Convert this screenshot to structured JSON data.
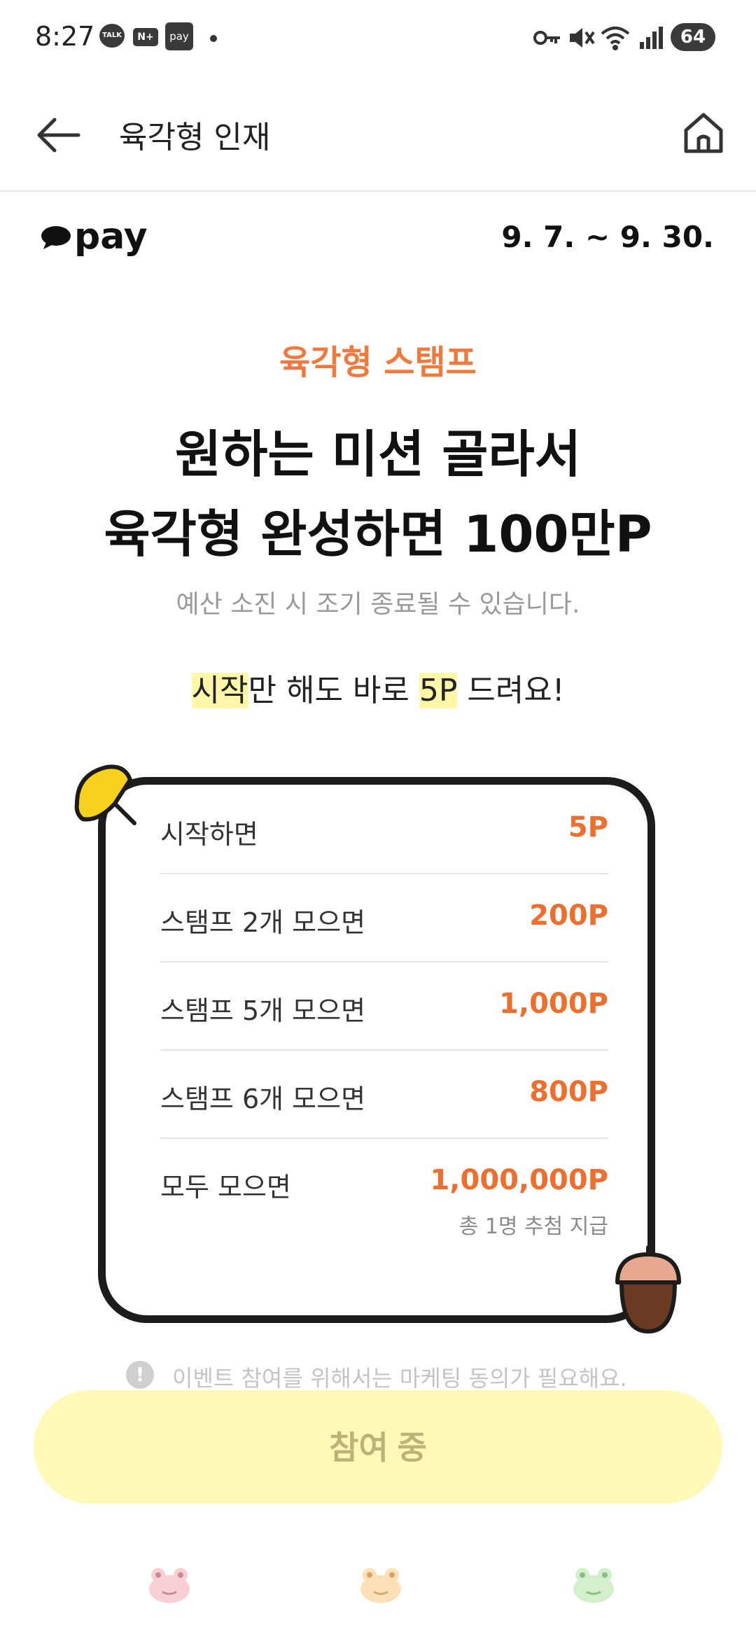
{
  "status_bar": {
    "time": "8:27",
    "app_icons": [
      "TALK",
      "N+",
      "pay"
    ],
    "battery": "64"
  },
  "header": {
    "title": "육각형 인재",
    "icons": [
      "back-arrow-icon",
      "home-icon"
    ]
  },
  "promo": {
    "brand": "pay",
    "dates": "9. 7. ~ 9. 30.",
    "subtitle": "육각형 스탬프",
    "headline_line1": "원하는 미션 골라서",
    "headline_line2": "육각형 완성하면 100만P",
    "notice": "예산 소진 시 조기 종료될 수 있습니다.",
    "start_hl1": "시작",
    "start_mid": "만 해도 바로 ",
    "start_hl2": "5P",
    "start_end": " 드려요!"
  },
  "rewards": [
    {
      "label": "시작하면",
      "points": "5P"
    },
    {
      "label": "스탬프 2개 모으면",
      "points": "200P"
    },
    {
      "label": "스탬프 5개 모으면",
      "points": "1,000P"
    },
    {
      "label": "스탬프 6개 모으면",
      "points": "800P"
    },
    {
      "label": "모두 모으면",
      "points": "1,000,000P",
      "note": "총 1명 추첨 지급"
    }
  ],
  "info_text": "이벤트 참여를 위해서는 마케팅 동의가 필요해요.",
  "cta_label": "참여 중",
  "colors": {
    "accent_orange": "#ee6f2d",
    "highlight_yellow": "#fff7a8",
    "button_yellow": "#fff9b8"
  }
}
